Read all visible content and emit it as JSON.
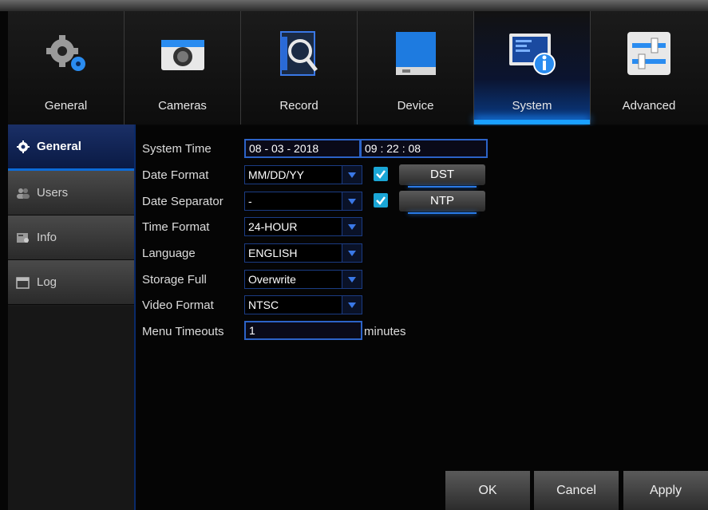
{
  "tabs": [
    {
      "label": "General",
      "icon": "gears-icon"
    },
    {
      "label": "Cameras",
      "icon": "camera-icon"
    },
    {
      "label": "Record",
      "icon": "record-magnifier-icon"
    },
    {
      "label": "Device",
      "icon": "hard-drive-icon"
    },
    {
      "label": "System",
      "icon": "system-info-icon",
      "active": true
    },
    {
      "label": "Advanced",
      "icon": "sliders-icon"
    }
  ],
  "sidebar": {
    "items": [
      {
        "label": "General",
        "icon": "gear-icon",
        "active": true
      },
      {
        "label": "Users",
        "icon": "users-icon"
      },
      {
        "label": "Info",
        "icon": "info-card-icon"
      },
      {
        "label": "Log",
        "icon": "log-calendar-icon"
      }
    ]
  },
  "form": {
    "system_time": {
      "label": "System Time",
      "date": "08  -  03  -  2018",
      "time": "09  :  22  :  08"
    },
    "date_format": {
      "label": "Date Format",
      "value": "MM/DD/YY"
    },
    "date_separator": {
      "label": "Date Separator",
      "value": "-"
    },
    "time_format": {
      "label": "Time Format",
      "value": "24-HOUR"
    },
    "language": {
      "label": "Language",
      "value": "ENGLISH"
    },
    "storage_full": {
      "label": "Storage Full",
      "value": "Overwrite"
    },
    "video_format": {
      "label": "Video Format",
      "value": "NTSC"
    },
    "menu_timeouts": {
      "label": "Menu Timeouts",
      "value": "1",
      "unit": "minutes"
    },
    "dst": {
      "label": "DST",
      "checked": true
    },
    "ntp": {
      "label": "NTP",
      "checked": true
    }
  },
  "footer": {
    "ok": "OK",
    "cancel": "Cancel",
    "apply": "Apply"
  },
  "colors": {
    "accent": "#1aa0ff",
    "border": "#2c63c7",
    "active_side": "#1a2f66"
  }
}
